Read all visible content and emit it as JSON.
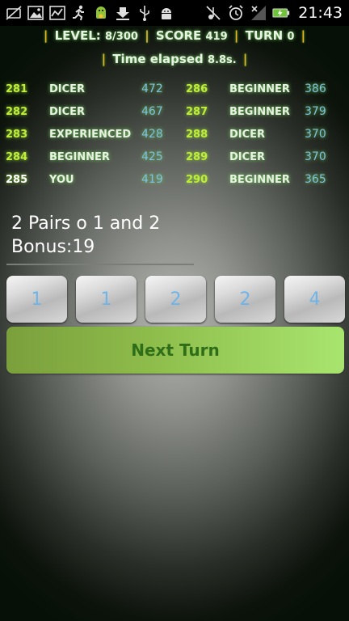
{
  "status_bar": {
    "time": "21:43",
    "icons": [
      "no-sim-icon",
      "image-icon",
      "activity-icon",
      "runner-icon",
      "android-icon",
      "download-icon",
      "usb-icon",
      "android-debug-icon",
      "mute-icon",
      "alarm-icon",
      "no-signal-icon",
      "battery-charging-icon"
    ]
  },
  "header": {
    "level_label": "LEVEL:",
    "level_value": "8/300",
    "score_label": "SCORE",
    "score_value": "419",
    "turn_label": "TURN",
    "turn_value": "0",
    "time_label": "Time elapsed",
    "time_value": "8.8s.",
    "separator": "|"
  },
  "leaderboard": [
    {
      "rank": "281",
      "name": "DICER",
      "score": "472"
    },
    {
      "rank": "282",
      "name": "DICER",
      "score": "467"
    },
    {
      "rank": "283",
      "name": "EXPERIENCED",
      "score": "428"
    },
    {
      "rank": "284",
      "name": "BEGINNER",
      "score": "425"
    },
    {
      "rank": "285",
      "name": "YOU",
      "score": "419"
    },
    {
      "rank": "286",
      "name": "BEGINNER",
      "score": "386"
    },
    {
      "rank": "287",
      "name": "BEGINNER",
      "score": "379"
    },
    {
      "rank": "288",
      "name": "DICER",
      "score": "370"
    },
    {
      "rank": "289",
      "name": "DICER",
      "score": "370"
    },
    {
      "rank": "290",
      "name": "BEGINNER",
      "score": "365"
    }
  ],
  "combo": {
    "line1": "2 Pairs o 1 and 2",
    "line2": "Bonus:19"
  },
  "dice": [
    "1",
    "1",
    "2",
    "2",
    "4"
  ],
  "next_turn_label": "Next Turn",
  "colors": {
    "rank": "#c2ec3a",
    "score": "#7ec0e0",
    "button_start": "#7a9f3c",
    "button_end": "#a8e56e",
    "button_text": "#2e6e18",
    "die_text": "#6fb4e8"
  }
}
